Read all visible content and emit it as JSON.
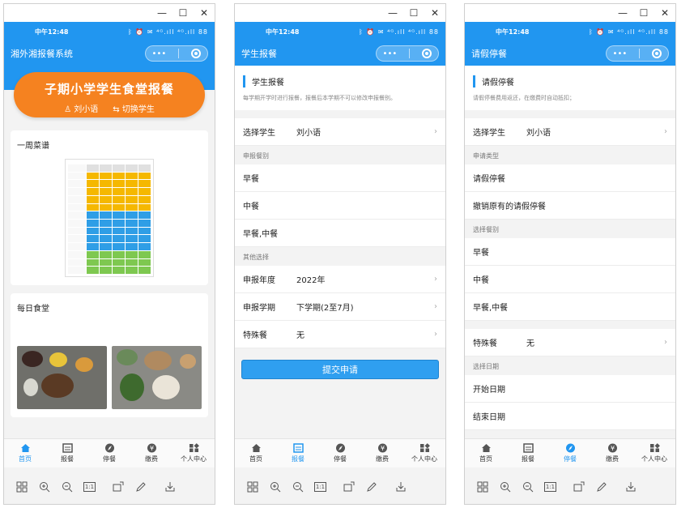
{
  "window_controls": {
    "minimize": "—",
    "maximize": "☐",
    "close": "✕"
  },
  "status": {
    "time": "中午12:48",
    "system": "ᛒ ⏰ ✉ ⁴ᴳ.ıll ⁴ᴳ.ıll 88"
  },
  "capsule": {
    "more": "•••"
  },
  "tabs": [
    {
      "label": "首页",
      "icon": "home-icon"
    },
    {
      "label": "报餐",
      "icon": "order-icon"
    },
    {
      "label": "停餐",
      "icon": "compass-icon"
    },
    {
      "label": "缴费",
      "icon": "yen-icon"
    },
    {
      "label": "个人中心",
      "icon": "grid-icon"
    }
  ],
  "toolbar": {
    "fit": "1:1"
  },
  "home": {
    "nav_title": "湘外湘报餐系统",
    "hero_title": "子期小学学生食堂报餐",
    "student": "刘小语",
    "switch": "切换学生",
    "menu_title": "一周菜谱",
    "daily_title": "每日食堂"
  },
  "report": {
    "nav_title": "学生报餐",
    "head_title": "学生报餐",
    "head_desc": "每学期开学时进行报餐，报餐后本学期不可以修改申报餐别。",
    "select_student_label": "选择学生",
    "select_student_value": "刘小语",
    "meal_group": "申报餐别",
    "meals": [
      "早餐",
      "中餐",
      "早餐,中餐"
    ],
    "other_group": "其他选择",
    "year_label": "申报年度",
    "year_value": "2022年",
    "term_label": "申报学期",
    "term_value": "下学期(2至7月)",
    "special_label": "特殊餐",
    "special_value": "无",
    "submit": "提交申请"
  },
  "leave": {
    "nav_title": "请假停餐",
    "head_title": "请假停餐",
    "head_desc": "请假停餐费用返还，在缴费时自动抵扣；",
    "select_student_label": "选择学生",
    "select_student_value": "刘小语",
    "type_group": "申请类型",
    "types": [
      "请假停餐",
      "撤销原有的请假停餐"
    ],
    "meal_group": "选择餐别",
    "meals": [
      "早餐",
      "中餐",
      "早餐,中餐"
    ],
    "special_label": "特殊餐",
    "special_value": "无",
    "date_group": "选择日期",
    "start_date": "开始日期",
    "end_date": "结束日期"
  }
}
